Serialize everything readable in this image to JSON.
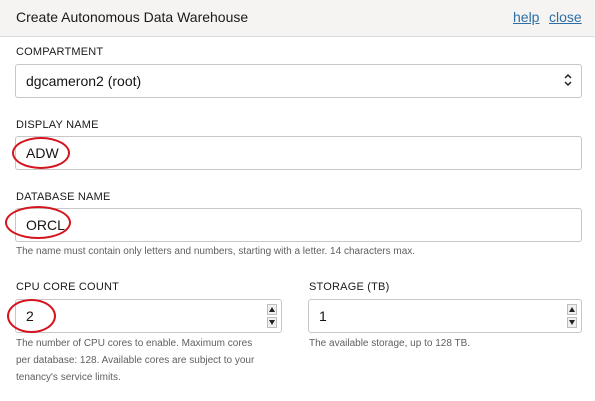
{
  "dialog": {
    "title": "Create Autonomous Data Warehouse",
    "help_link": "help",
    "close_link": "close"
  },
  "compartment": {
    "label": "COMPARTMENT",
    "value": "dgcameron2 (root)"
  },
  "display_name": {
    "label": "DISPLAY NAME",
    "value": "ADW"
  },
  "database_name": {
    "label": "DATABASE NAME",
    "value": "ORCL",
    "help": "The name must contain only letters and numbers, starting with a letter. 14 characters max."
  },
  "cpu_core_count": {
    "label": "CPU CORE COUNT",
    "value": "2",
    "help_line1": "The number of CPU cores to enable. Maximum cores",
    "help_line2": "per database: 128. Available cores are subject to your",
    "help_line3": "tenancy's service limits."
  },
  "storage": {
    "label": "STORAGE (TB)",
    "value": "1",
    "help": "The available storage, up to 128 TB."
  },
  "colors": {
    "link": "#2e6ea6",
    "highlight_ring": "#d5141e"
  }
}
